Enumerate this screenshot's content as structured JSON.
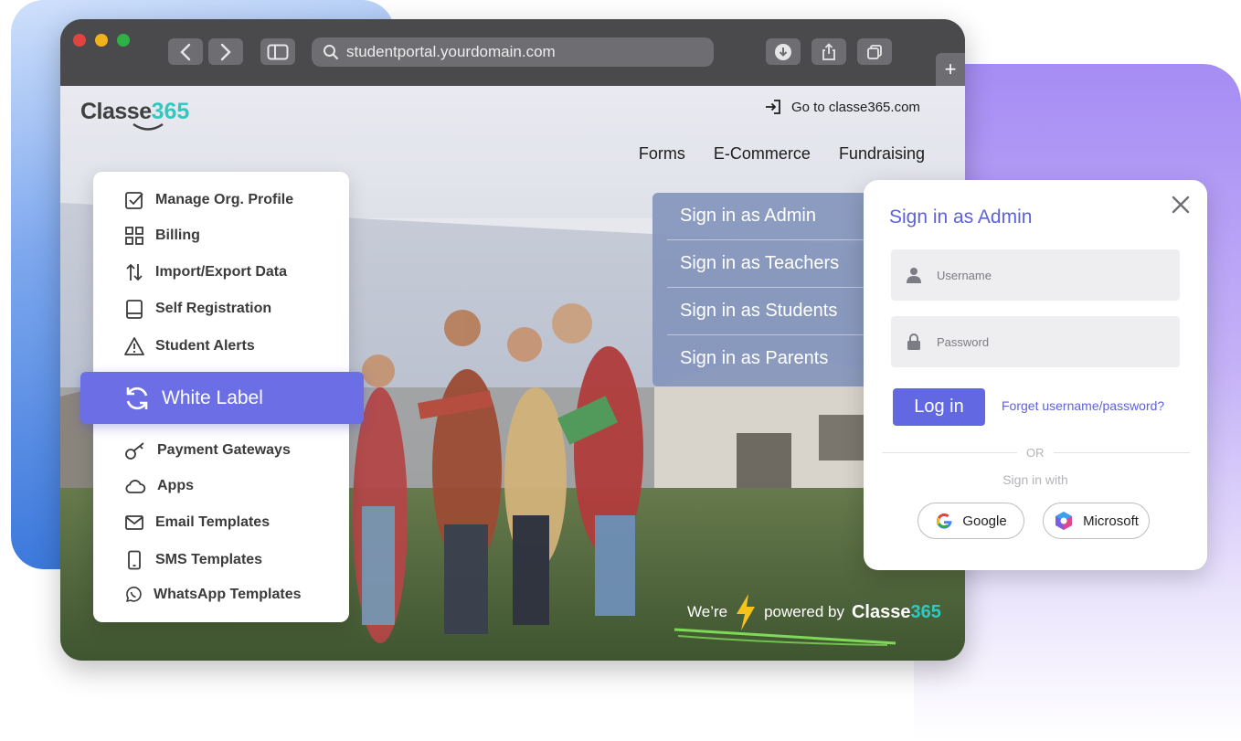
{
  "browser": {
    "url": "studentportal.yourdomain.com",
    "new_tab_label": "+"
  },
  "site": {
    "logo_word": "Classe",
    "logo_number": "365",
    "goto_link": "Go to classe365.com",
    "nav": [
      "Forms",
      "E-Commerce",
      "Fundraising"
    ],
    "powered_prefix": "We’re",
    "powered_by": "powered by",
    "powered_brand_word": "Classe",
    "powered_brand_number": "365"
  },
  "sign_menu": {
    "items": [
      "Sign in as Admin",
      "Sign in as Teachers",
      "Sign in as Students",
      "Sign in as Parents"
    ]
  },
  "admin_menu": {
    "items": [
      {
        "label": "Manage Org. Profile",
        "icon": "checkbox-icon"
      },
      {
        "label": "Billing",
        "icon": "grid-icon"
      },
      {
        "label": "Import/Export Data",
        "icon": "arrows-updown-icon"
      },
      {
        "label": "Self Registration",
        "icon": "book-icon"
      },
      {
        "label": "Student Alerts",
        "icon": "warning-icon"
      },
      {
        "label": "White Label",
        "icon": "refresh-icon",
        "highlighted": true
      },
      {
        "label": "Payment Gateways",
        "icon": "key-icon"
      },
      {
        "label": "Apps",
        "icon": "cloud-icon"
      },
      {
        "label": "Email Templates",
        "icon": "mail-icon"
      },
      {
        "label": "SMS Templates",
        "icon": "phone-icon"
      },
      {
        "label": "WhatsApp Templates",
        "icon": "whatsapp-icon"
      }
    ],
    "highlight_color": "#6b6ee4"
  },
  "signin_card": {
    "title": "Sign in as Admin",
    "username_placeholder": "Username",
    "password_placeholder": "Password",
    "login_label": "Log in",
    "forgot_label": "Forget username/password?",
    "or_label": "OR",
    "sign_in_with": "Sign in with",
    "google_label": "Google",
    "microsoft_label": "Microsoft",
    "accent": "#6168e2"
  }
}
